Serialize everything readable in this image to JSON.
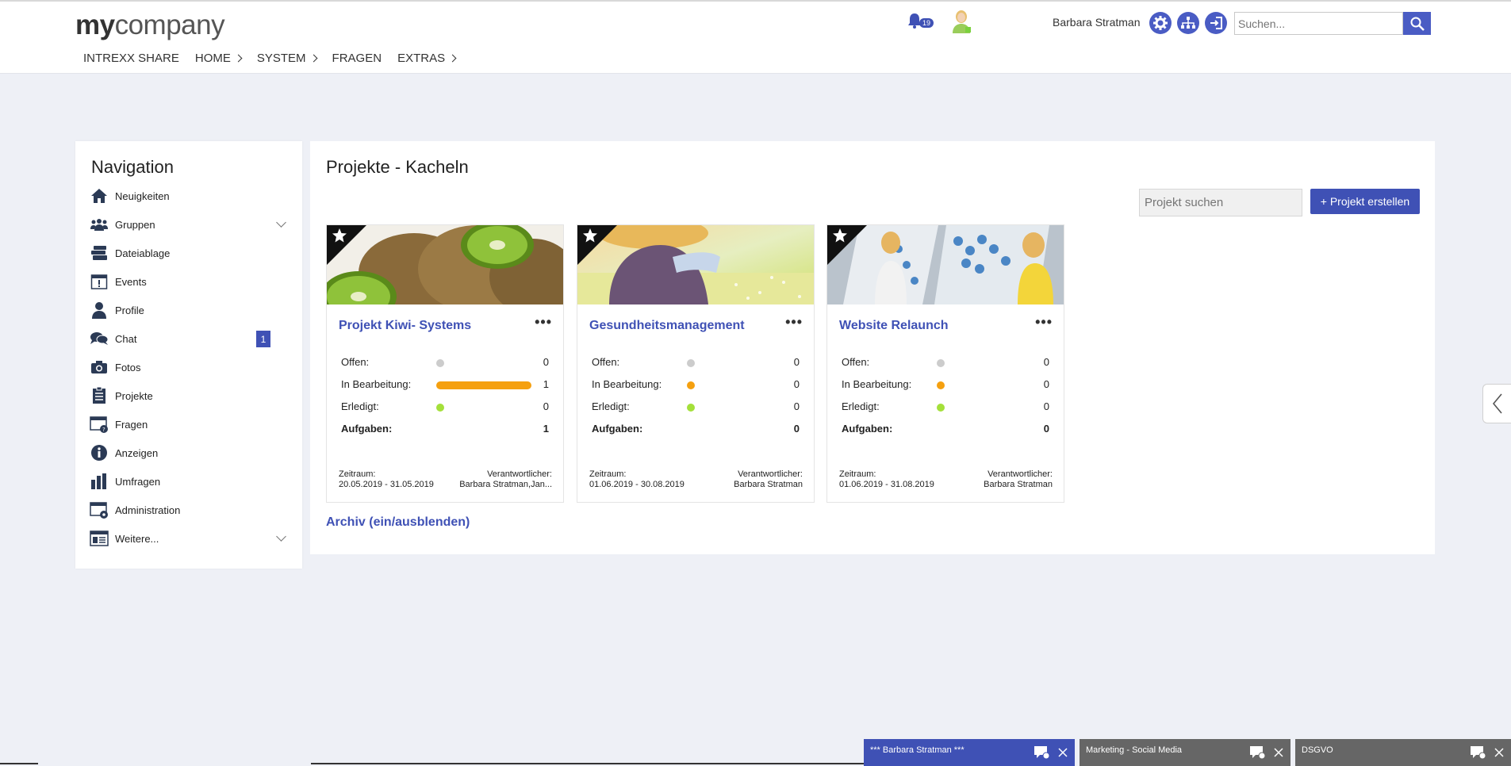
{
  "header": {
    "logo_bold": "my",
    "logo_rest": "company",
    "nav": [
      {
        "label": "INTREXX SHARE"
      },
      {
        "label": "HOME"
      },
      {
        "label": "SYSTEM"
      },
      {
        "label": "FRAGEN"
      },
      {
        "label": "EXTRAS"
      }
    ],
    "notification_count": "19",
    "username": "Barbara Stratman",
    "search_placeholder": "Suchen..."
  },
  "sidebar": {
    "title": "Navigation",
    "items": [
      {
        "label": "Neuigkeiten",
        "icon": "home-icon"
      },
      {
        "label": "Gruppen",
        "icon": "group-icon"
      },
      {
        "label": "Dateiablage",
        "icon": "files-icon"
      },
      {
        "label": "Events",
        "icon": "calendar-icon"
      },
      {
        "label": "Profile",
        "icon": "person-icon"
      },
      {
        "label": "Chat",
        "icon": "chat-icon",
        "badge": "1"
      },
      {
        "label": "Fotos",
        "icon": "camera-icon"
      },
      {
        "label": "Projekte",
        "icon": "clipboard-icon"
      },
      {
        "label": "Fragen",
        "icon": "question-window-icon"
      },
      {
        "label": "Anzeigen",
        "icon": "info-icon"
      },
      {
        "label": "Umfragen",
        "icon": "bar-chart-icon"
      },
      {
        "label": "Administration",
        "icon": "admin-window-icon"
      },
      {
        "label": "Weitere...",
        "icon": "more-window-icon"
      }
    ]
  },
  "main": {
    "title": "Projekte - Kacheln",
    "search_placeholder": "Projekt suchen",
    "create_label": "+ Projekt erstellen",
    "archive_label": "Archiv (ein/ausblenden)",
    "stat_labels": {
      "open": "Offen:",
      "in_progress": "In Bearbeitung:",
      "done": "Erledigt:",
      "tasks": "Aufgaben:"
    },
    "footer_labels": {
      "period": "Zeitraum:",
      "responsible": "Verantwortlicher:"
    },
    "projects": [
      {
        "title": "Projekt Kiwi- Systems",
        "open": "0",
        "in_progress": "1",
        "done": "0",
        "tasks": "1",
        "period": "20.05.2019 - 31.05.2019",
        "responsible": "Barbara Stratman,Jan..."
      },
      {
        "title": "Gesundheitsmanagement",
        "open": "0",
        "in_progress": "0",
        "done": "0",
        "tasks": "0",
        "period": "01.06.2019 - 30.08.2019",
        "responsible": "Barbara Stratman"
      },
      {
        "title": "Website Relaunch",
        "open": "0",
        "in_progress": "0",
        "done": "0",
        "tasks": "0",
        "period": "01.06.2019 - 31.08.2019",
        "responsible": "Barbara Stratman"
      }
    ]
  },
  "chatbars": [
    {
      "label": "*** Barbara Stratman ***"
    },
    {
      "label": "Marketing - Social Media"
    },
    {
      "label": "DSGVO"
    }
  ],
  "colors": {
    "accent": "#3f51b5",
    "orange": "#f5a00f",
    "green": "#a4e03a",
    "gray_dot": "#cccccc"
  }
}
